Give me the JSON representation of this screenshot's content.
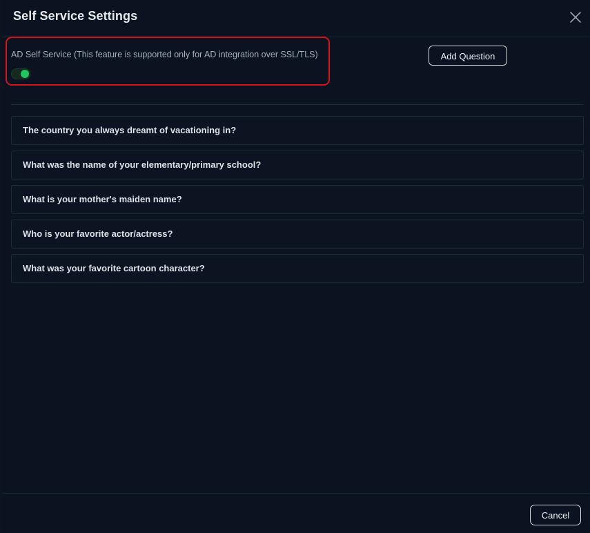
{
  "dialog": {
    "title": "Self Service Settings",
    "close_icon": "close-icon"
  },
  "ad_self_service": {
    "label": "AD Self Service (This feature is supported only for AD integration over SSL/TLS)",
    "enabled": true,
    "toggle_on_color": "#22c55e",
    "highlight_color": "#d3141b"
  },
  "toolbar": {
    "add_question_label": "Add Question"
  },
  "questions": [
    "The country you always dreamt of vacationing in?",
    "What was the name of your elementary/primary school?",
    "What is your mother's maiden name?",
    "Who is your favorite actor/actress?",
    "What was your favorite cartoon character?"
  ],
  "footer": {
    "cancel_label": "Cancel"
  }
}
